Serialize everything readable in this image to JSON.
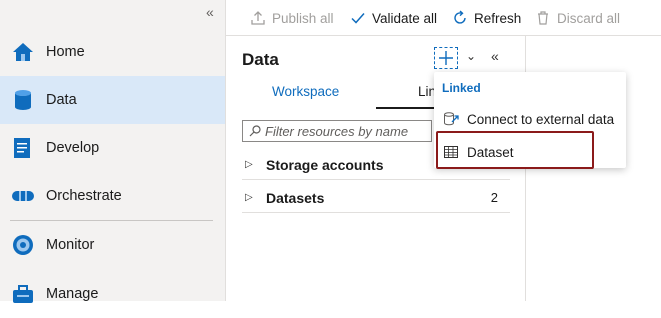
{
  "nav": {
    "collapse_glyph": "«",
    "items": [
      {
        "label": "Home",
        "icon": "home-icon"
      },
      {
        "label": "Data",
        "icon": "database-icon",
        "active": true
      },
      {
        "label": "Develop",
        "icon": "document-icon"
      },
      {
        "label": "Orchestrate",
        "icon": "pipeline-icon"
      },
      {
        "label": "Monitor",
        "icon": "gauge-icon"
      },
      {
        "label": "Manage",
        "icon": "toolbox-icon"
      }
    ]
  },
  "toolbar": {
    "publish_label": "Publish all",
    "validate_label": "Validate all",
    "refresh_label": "Refresh",
    "discard_label": "Discard all"
  },
  "panel": {
    "title": "Data",
    "collapse_glyph": "«",
    "chevron_glyph": "⌄",
    "tabs": [
      {
        "label": "Workspace"
      },
      {
        "label": "Linked",
        "visible_text": "Lin"
      }
    ],
    "search": {
      "placeholder": "Filter resources by name"
    },
    "tree": [
      {
        "label": "Storage accounts",
        "count": ""
      },
      {
        "label": "Datasets",
        "count": "2"
      }
    ]
  },
  "menu": {
    "header": "Linked",
    "items": [
      {
        "label": "Connect to external data",
        "icon": "external-link-icon"
      },
      {
        "label": "Dataset",
        "icon": "table-icon"
      }
    ]
  },
  "colors": {
    "accent": "#0f6cbd",
    "nav_bg": "#f3f2f1",
    "nav_active": "#d9e8f8",
    "highlight_border": "#8b1a1a"
  }
}
